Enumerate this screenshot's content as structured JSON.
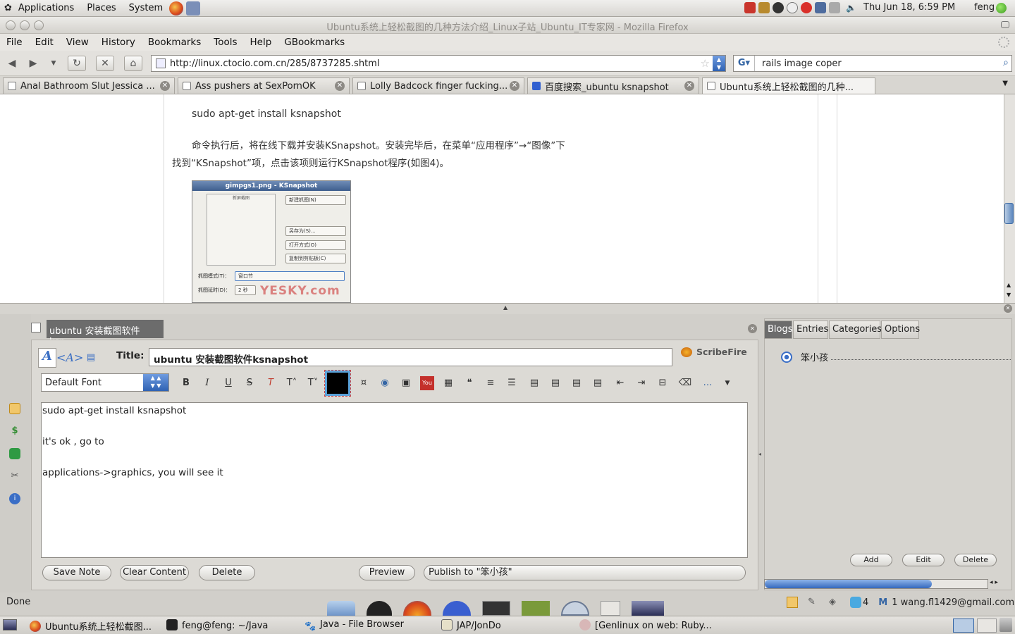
{
  "top_panel": {
    "menus": [
      "Applications",
      "Places",
      "System"
    ],
    "clock": "Thu Jun 18,  6:59 PM",
    "user": "feng"
  },
  "window": {
    "title": "Ubuntu系统上轻松截图的几种方法介绍_Linux子站_Ubuntu_IT专家网 - Mozilla Firefox"
  },
  "menubar": [
    "File",
    "Edit",
    "View",
    "History",
    "Bookmarks",
    "Tools",
    "Help",
    "GBookmarks"
  ],
  "nav": {
    "url": "http://linux.ctocio.com.cn/285/8737285.shtml",
    "search_value": "rails image coper"
  },
  "tabs": [
    {
      "label": "Anal Bathroom Slut Jessica ..."
    },
    {
      "label": "Ass pushers at SexPornOK"
    },
    {
      "label": "Lolly Badcock finger fucking..."
    },
    {
      "label": "百度搜索_ubuntu ksnapshot"
    },
    {
      "label": "Ubuntu系统上轻松截图的几种..."
    }
  ],
  "page": {
    "command": "sudo apt-get install ksnapshot",
    "para_line1": "命令执行后，将在线下载并安装KSnapshot。安装完毕后，在菜单“应用程序”→“图像”下",
    "para_line2": "找到“KSnapshot”项，点击该项则运行KSnapshot程序(如图4)。",
    "figure": {
      "window_title": "gimpgs1.png - KSnapshot",
      "group_title": "新屏截图",
      "btn_new": "新建抓图(N)",
      "btn_save": "另存为(S)...",
      "btn_open": "打开方式(O)",
      "btn_copy": "复制到剪贴板(C)",
      "label_mode": "抓图模式(T)：",
      "mode_value": "窗口节",
      "label_delay": "抓图延时(D)：",
      "delay_value": "2 秒",
      "watermark": "YESKY.com"
    }
  },
  "scribefire": {
    "tab_title": "ubuntu 安装截图软件ksn...",
    "title_label": "Title:",
    "title_value": "ubuntu 安装截图软件ksnapshot",
    "brand": "ScribeFire",
    "font_select": "Default Font",
    "body_lines": [
      "sudo apt-get install ksnapshot",
      "it's ok , go to",
      "applications->graphics, you will see it"
    ],
    "buttons": {
      "save_note": "Save Note",
      "clear_content": "Clear Content",
      "delete": "Delete",
      "preview": "Preview",
      "publish": "Publish to \"笨小孩\""
    },
    "right_tabs": [
      "Blogs",
      "Entries",
      "Categories",
      "Options"
    ],
    "blog_name": "笨小孩",
    "right_buttons": {
      "add": "Add",
      "edit": "Edit",
      "delete": "Delete"
    }
  },
  "status": {
    "text": "Done",
    "twitter_count": "4",
    "gmail": "1 wang.fl1429@gmail.com"
  },
  "taskbar": [
    "Ubuntu系统上轻松截图...",
    "feng@feng: ~/Java",
    "Java - File Browser",
    "JAP/JonDo",
    "[Genlinux on web: Ruby..."
  ]
}
